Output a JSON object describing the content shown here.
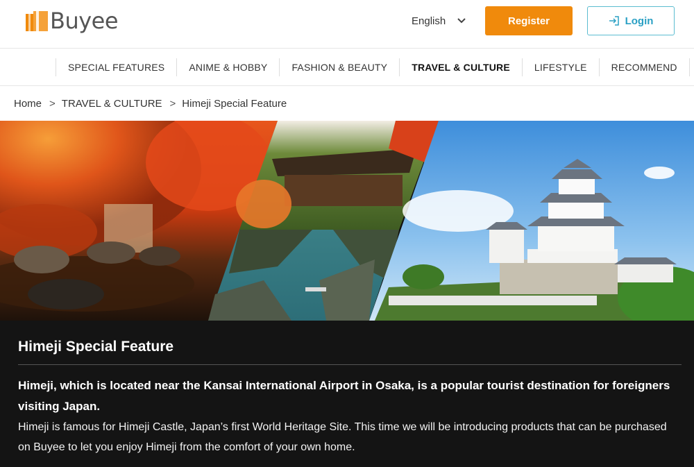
{
  "header": {
    "logo_text": "Buyee",
    "language": "English",
    "register_label": "Register",
    "login_label": "Login",
    "brand_color": "#f08a0c",
    "login_color": "#2aa0c4"
  },
  "nav": {
    "items": [
      {
        "label": "SPECIAL FEATURES"
      },
      {
        "label": "ANIME & HOBBY"
      },
      {
        "label": "FASHION & BEAUTY"
      },
      {
        "label": "TRAVEL & CULTURE",
        "active": true
      },
      {
        "label": "LIFESTYLE"
      },
      {
        "label": "RECOMMEND"
      }
    ]
  },
  "breadcrumb": {
    "home": "Home",
    "sep": ">",
    "category": "TRAVEL & CULTURE",
    "current": "Himeji Special Feature"
  },
  "feature": {
    "title": "Himeji Special Feature",
    "lead": "Himeji, which is located near the Kansai International Airport in Osaka, is a popular tourist destination for foreigners visiting Japan.",
    "body": "Himeji is famous for Himeji Castle, Japan’s first World Heritage Site. This time we will be introducing products that can be purchased on Buyee to let you enjoy Himeji from the comfort of your own home."
  }
}
